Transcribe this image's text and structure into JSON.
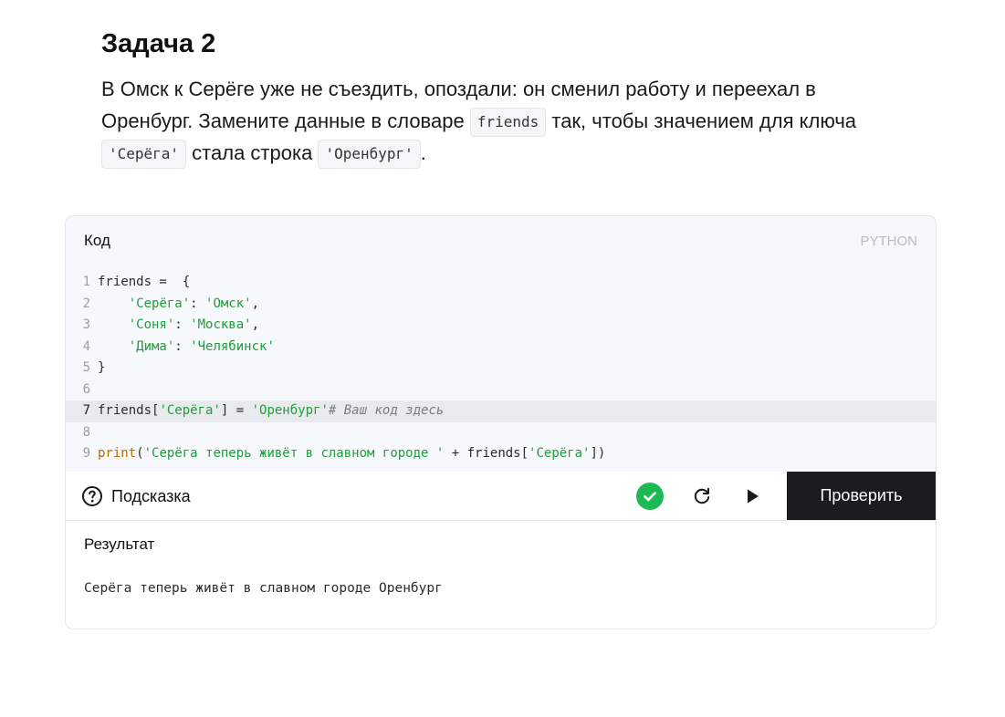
{
  "task": {
    "title": "Задача 2",
    "text_part1": "В Омск к Серёге уже не съездить, опоздали: он сменил работу и переехал в Оренбург. Замените данные в словаре ",
    "code1": "friends",
    "text_part2": " так, чтобы значением для ключа ",
    "code2": "'Серёга'",
    "text_part3": " стала строка ",
    "code3": "'Оренбург'",
    "text_part4": "."
  },
  "editor": {
    "label": "Код",
    "language": "PYTHON",
    "active_line": 7,
    "lines": [
      {
        "num": "1",
        "parts": [
          {
            "t": "friends =  {",
            "c": ""
          }
        ]
      },
      {
        "num": "2",
        "parts": [
          {
            "t": "    ",
            "c": ""
          },
          {
            "t": "'Серёга'",
            "c": "s"
          },
          {
            "t": ": ",
            "c": ""
          },
          {
            "t": "'Омск'",
            "c": "s"
          },
          {
            "t": ",",
            "c": ""
          }
        ]
      },
      {
        "num": "3",
        "parts": [
          {
            "t": "    ",
            "c": ""
          },
          {
            "t": "'Соня'",
            "c": "s"
          },
          {
            "t": ": ",
            "c": ""
          },
          {
            "t": "'Москва'",
            "c": "s"
          },
          {
            "t": ",",
            "c": ""
          }
        ]
      },
      {
        "num": "4",
        "parts": [
          {
            "t": "    ",
            "c": ""
          },
          {
            "t": "'Дима'",
            "c": "s"
          },
          {
            "t": ": ",
            "c": ""
          },
          {
            "t": "'Челябинск'",
            "c": "s"
          }
        ]
      },
      {
        "num": "5",
        "parts": [
          {
            "t": "}",
            "c": ""
          }
        ]
      },
      {
        "num": "6",
        "parts": []
      },
      {
        "num": "7",
        "parts": [
          {
            "t": "friends[",
            "c": ""
          },
          {
            "t": "'Серёга'",
            "c": "s"
          },
          {
            "t": "] = ",
            "c": ""
          },
          {
            "t": "'Оренбург'",
            "c": "s"
          },
          {
            "t": "# Ваш код здесь",
            "c": "c"
          }
        ]
      },
      {
        "num": "8",
        "parts": []
      },
      {
        "num": "9",
        "parts": [
          {
            "t": "print",
            "c": "k"
          },
          {
            "t": "(",
            "c": ""
          },
          {
            "t": "'Серёга теперь живёт в славном городе '",
            "c": "s"
          },
          {
            "t": " + friends[",
            "c": ""
          },
          {
            "t": "'Серёга'",
            "c": "s"
          },
          {
            "t": "])",
            "c": ""
          }
        ]
      }
    ]
  },
  "toolbar": {
    "hint_label": "Подсказка",
    "hint_icon": "question-circle-icon",
    "success_icon": "check-circle-icon",
    "reset_icon": "reset-icon",
    "run_icon": "play-icon",
    "check_label": "Проверить",
    "success_color": "#1db954"
  },
  "result": {
    "label": "Результат",
    "output": "Серёга теперь живёт в славном городе Оренбург"
  }
}
